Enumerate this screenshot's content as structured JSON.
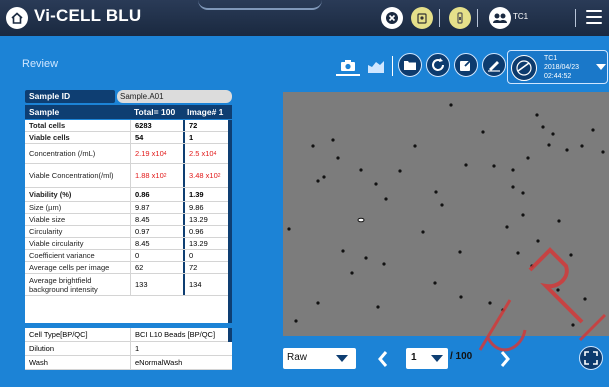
{
  "app": {
    "title": "Vi-CELL BLU",
    "user": "TC1"
  },
  "page": {
    "title": "Review"
  },
  "user_card": {
    "name": "TC1",
    "date": "2018/04/23",
    "time": "02:44:52"
  },
  "sample": {
    "id_label": "Sample ID",
    "id_value": "Sample.A01",
    "header": {
      "name": "Sample",
      "total": "Total= 100",
      "image": "Image# 1"
    }
  },
  "rows": [
    {
      "label": "Total cells",
      "total": "6283",
      "image": "72",
      "style": "bold"
    },
    {
      "label": "Viable cells",
      "total": "54",
      "image": "1",
      "style": "bold"
    },
    {
      "label": "Concentration (/mL)",
      "total": "2.19 x10",
      "total_exp": "4",
      "image": "2.5 x10",
      "image_exp": "4",
      "style": "red"
    },
    {
      "label": "Viable Concentration(/ml)",
      "total": "1.88 x10",
      "total_exp": "2",
      "image": "3.48 x10",
      "image_exp": "2",
      "style": "red"
    },
    {
      "label": "Viability (%)",
      "total": "0.86",
      "image": "1.39",
      "style": "bold"
    },
    {
      "label": "Size (µm)",
      "total": "9.87",
      "image": "9.86",
      "style": ""
    },
    {
      "label": "Viable size",
      "total": "8.45",
      "image": "13.29",
      "style": ""
    },
    {
      "label": "Circularity",
      "total": "0.97",
      "image": "0.96",
      "style": ""
    },
    {
      "label": "Viable circularity",
      "total": "8.45",
      "image": "13.29",
      "style": ""
    },
    {
      "label": "Coefficient variance",
      "total": "0",
      "image": "0",
      "style": ""
    },
    {
      "label": "Average cells per image",
      "total": "62",
      "image": "72",
      "style": ""
    },
    {
      "label": "Average brightfield background intensity",
      "total": "133",
      "image": "134",
      "style": ""
    }
  ],
  "details": [
    {
      "label": "Cell Type[BP/QC]",
      "value": "BCI L10 Beads [BP/QC]"
    },
    {
      "label": "Dilution",
      "value": "1"
    },
    {
      "label": "Wash",
      "value": "eNormalWash"
    }
  ],
  "viewer": {
    "mode": "Raw",
    "page": "1",
    "total": "/ 100"
  },
  "colors": {
    "accent": "#1c83d6",
    "dark": "#0e3e72",
    "highlight": "#e21a1a"
  },
  "icons": [
    "home-icon",
    "close-circle-icon",
    "settings-icon",
    "lock-icon",
    "users-icon",
    "menu-icon",
    "camera-icon",
    "chart-icon",
    "folder-icon",
    "refresh-icon",
    "export-icon",
    "sign-icon",
    "fullscreen-icon"
  ]
}
